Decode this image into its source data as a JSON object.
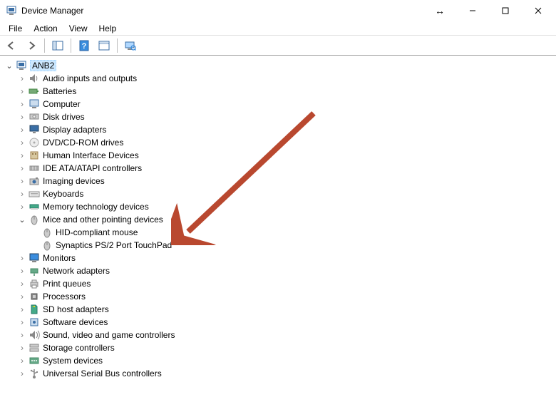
{
  "titlebar": {
    "title": "Device Manager"
  },
  "menubar": {
    "items": [
      {
        "label": "File"
      },
      {
        "label": "Action"
      },
      {
        "label": "View"
      },
      {
        "label": "Help"
      }
    ]
  },
  "toolbar": {
    "back_tooltip": "Back",
    "forward_tooltip": "Forward",
    "show_hide_tooltip": "Show/Hide Console Tree",
    "help_tooltip": "Help",
    "properties_tooltip": "Properties",
    "scan_tooltip": "Scan for hardware changes"
  },
  "tree": {
    "root": {
      "label": "ANB2",
      "expanded": true
    },
    "categories": [
      {
        "label": "Audio inputs and outputs",
        "icon": "audio"
      },
      {
        "label": "Batteries",
        "icon": "battery"
      },
      {
        "label": "Computer",
        "icon": "computer"
      },
      {
        "label": "Disk drives",
        "icon": "disk"
      },
      {
        "label": "Display adapters",
        "icon": "display"
      },
      {
        "label": "DVD/CD-ROM drives",
        "icon": "cd"
      },
      {
        "label": "Human Interface Devices",
        "icon": "hid"
      },
      {
        "label": "IDE ATA/ATAPI controllers",
        "icon": "ide"
      },
      {
        "label": "Imaging devices",
        "icon": "imaging"
      },
      {
        "label": "Keyboards",
        "icon": "keyboard"
      },
      {
        "label": "Memory technology devices",
        "icon": "memory"
      },
      {
        "label": "Mice and other pointing devices",
        "icon": "mouse",
        "expanded": true,
        "children": [
          {
            "label": "HID-compliant mouse",
            "icon": "mouse"
          },
          {
            "label": "Synaptics PS/2 Port TouchPad",
            "icon": "mouse"
          }
        ]
      },
      {
        "label": "Monitors",
        "icon": "monitor"
      },
      {
        "label": "Network adapters",
        "icon": "network"
      },
      {
        "label": "Print queues",
        "icon": "printer"
      },
      {
        "label": "Processors",
        "icon": "cpu"
      },
      {
        "label": "SD host adapters",
        "icon": "sd"
      },
      {
        "label": "Software devices",
        "icon": "software"
      },
      {
        "label": "Sound, video and game controllers",
        "icon": "sound"
      },
      {
        "label": "Storage controllers",
        "icon": "storage"
      },
      {
        "label": "System devices",
        "icon": "system"
      },
      {
        "label": "Universal Serial Bus controllers",
        "icon": "usb"
      }
    ]
  },
  "annotation": {
    "arrow_color": "#b9482f"
  }
}
